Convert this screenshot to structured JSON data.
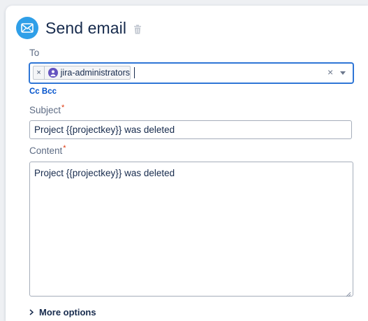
{
  "header": {
    "title": "Send email",
    "icon": "envelope-icon",
    "delete_icon": "trash-icon",
    "accent": "#2f9fe8"
  },
  "to": {
    "label": "To",
    "chips": [
      {
        "label": "jira-administrators",
        "icon": "group-avatar-icon"
      }
    ],
    "cc_bcc": "Cc Bcc"
  },
  "subject": {
    "label": "Subject",
    "required_mark": "*",
    "value": "Project {{projectkey}} was deleted"
  },
  "content": {
    "label": "Content",
    "required_mark": "*",
    "value": "Project {{projectkey}} was deleted"
  },
  "more_options": {
    "label": "More options"
  }
}
